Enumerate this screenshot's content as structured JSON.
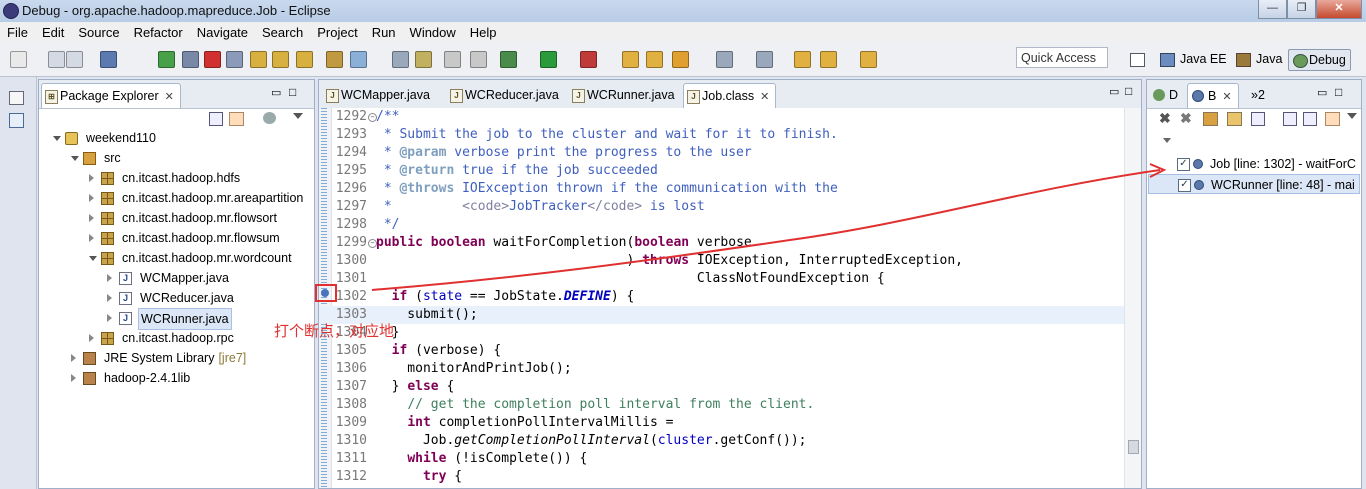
{
  "window": {
    "title": "Debug - org.apache.hadoop.mapreduce.Job - Eclipse",
    "min": "—",
    "max": "❐",
    "close": "✕"
  },
  "menu": [
    "File",
    "Edit",
    "Source",
    "Refactor",
    "Navigate",
    "Search",
    "Project",
    "Run",
    "Window",
    "Help"
  ],
  "toolbar": {
    "quick_access": "Quick Access"
  },
  "perspectives": {
    "javaee": "Java EE",
    "java": "Java",
    "debug": "Debug"
  },
  "package_explorer": {
    "tab_label": "Package Explorer",
    "tree": [
      {
        "label": "weekend110",
        "extra": "",
        "depth": 0,
        "icon": "project",
        "state": "open"
      },
      {
        "label": "src",
        "extra": "",
        "depth": 1,
        "icon": "src",
        "state": "open"
      },
      {
        "label": "cn.itcast.hadoop.hdfs",
        "extra": "",
        "depth": 2,
        "icon": "package",
        "state": "closed"
      },
      {
        "label": "cn.itcast.hadoop.mr.areapartition",
        "extra": "",
        "depth": 2,
        "icon": "package",
        "state": "closed"
      },
      {
        "label": "cn.itcast.hadoop.mr.flowsort",
        "extra": "",
        "depth": 2,
        "icon": "package",
        "state": "closed"
      },
      {
        "label": "cn.itcast.hadoop.mr.flowsum",
        "extra": "",
        "depth": 2,
        "icon": "package",
        "state": "closed"
      },
      {
        "label": "cn.itcast.hadoop.mr.wordcount",
        "extra": "",
        "depth": 2,
        "icon": "package",
        "state": "open"
      },
      {
        "label": "WCMapper.java",
        "extra": "",
        "depth": 3,
        "icon": "java",
        "state": "closed"
      },
      {
        "label": "WCReducer.java",
        "extra": "",
        "depth": 3,
        "icon": "java",
        "state": "closed"
      },
      {
        "label": "WCRunner.java",
        "extra": "",
        "depth": 3,
        "icon": "java",
        "state": "closed",
        "selected": true
      },
      {
        "label": "cn.itcast.hadoop.rpc",
        "extra": "",
        "depth": 2,
        "icon": "package",
        "state": "closed"
      },
      {
        "label": "JRE System Library",
        "extra": "[jre7]",
        "depth": 1,
        "icon": "library",
        "state": "closed"
      },
      {
        "label": "hadoop-2.4.1lib",
        "extra": "",
        "depth": 1,
        "icon": "library",
        "state": "closed"
      }
    ]
  },
  "editor": {
    "tabs": [
      "WCMapper.java",
      "WCReducer.java",
      "WCRunner.java",
      "Job.class"
    ],
    "active_tab": "Job.class",
    "lines": [
      {
        "n": "1292",
        "t": "/**",
        "k": "doc",
        "fold": true
      },
      {
        "n": "1293",
        "t": " * Submit the job to the cluster and wait for it to finish.",
        "k": "doc"
      },
      {
        "n": "1294",
        "t": " * @param verbose print the progress to the user",
        "k": "doc-tag",
        "tag": "@param"
      },
      {
        "n": "1295",
        "t": " * @return true if the job succeeded",
        "k": "doc-tag",
        "tag": "@return"
      },
      {
        "n": "1296",
        "t": " * @throws IOException thrown if the communication with the",
        "k": "doc-tag",
        "tag": "@throws"
      },
      {
        "n": "1297",
        "t": " *         <code>JobTracker</code> is lost",
        "k": "doc-html"
      },
      {
        "n": "1298",
        "t": " */",
        "k": "doc"
      },
      {
        "n": "1299",
        "t": "public boolean waitForCompletion(boolean verbose",
        "k": "code",
        "fold": true
      },
      {
        "n": "1300",
        "t": "                                ) throws IOException, InterruptedException,",
        "k": "code"
      },
      {
        "n": "1301",
        "t": "                                         ClassNotFoundException {",
        "k": "code"
      },
      {
        "n": "1302",
        "t": "  if (state == JobState.DEFINE) {",
        "k": "code",
        "breakpoint": true
      },
      {
        "n": "1303",
        "t": "    submit();",
        "k": "code",
        "current": true
      },
      {
        "n": "1304",
        "t": "  }",
        "k": "code"
      },
      {
        "n": "1305",
        "t": "  if (verbose) {",
        "k": "code"
      },
      {
        "n": "1306",
        "t": "    monitorAndPrintJob();",
        "k": "code"
      },
      {
        "n": "1307",
        "t": "  } else {",
        "k": "code"
      },
      {
        "n": "1308",
        "t": "    // get the completion poll interval from the client.",
        "k": "line-comment"
      },
      {
        "n": "1309",
        "t": "    int completionPollIntervalMillis =",
        "k": "code"
      },
      {
        "n": "1310",
        "t": "      Job.getCompletionPollInterval(cluster.getConf());",
        "k": "code"
      },
      {
        "n": "1311",
        "t": "    while (!isComplete()) {",
        "k": "code"
      },
      {
        "n": "1312",
        "t": "      try {",
        "k": "code"
      }
    ]
  },
  "breakpoints_view": {
    "tabs": [
      "D",
      "B",
      "»2"
    ],
    "items": [
      {
        "label": "Job [line: 1302] - waitForC",
        "checked": true
      },
      {
        "label": "WCRunner [line: 48] - mai",
        "checked": true
      }
    ]
  },
  "annotation": {
    "text": "打个断点，对应地"
  },
  "colors": {
    "annotation": "#e03030",
    "keyword": "#7f0055",
    "javadoc": "#3f5fbf",
    "field": "#0000c0",
    "comment": "#3f7f5f"
  }
}
